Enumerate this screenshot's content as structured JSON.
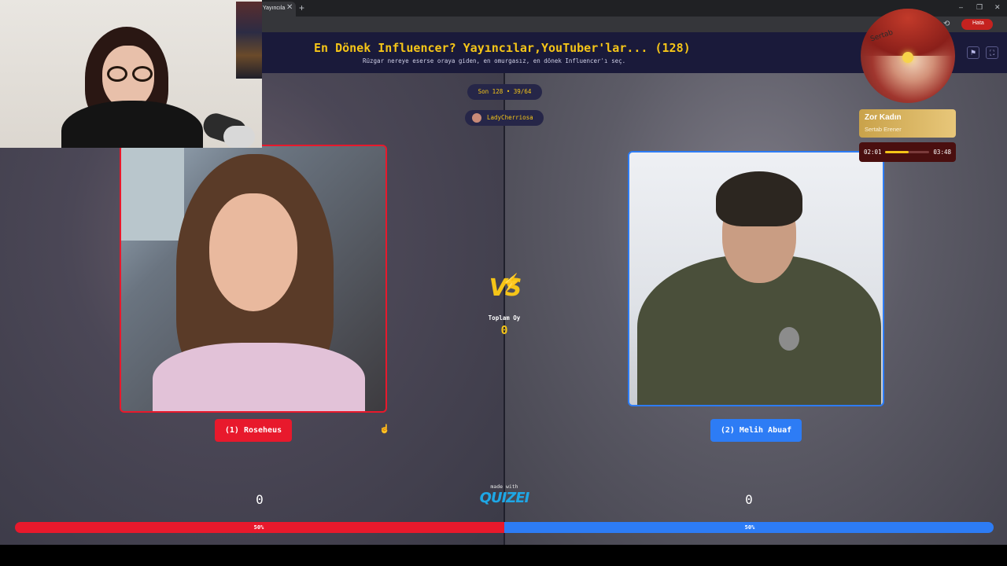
{
  "browser": {
    "tab_title": "Yayıncıla",
    "tab_close": "✕",
    "new_tab": "+",
    "minimize": "–",
    "restore": "❐",
    "close": "✕",
    "error_badge": "Hata"
  },
  "header": {
    "title": "En Dönek Influencer? Yayıncılar,YouTuber'lar... (128)",
    "subtitle": "Rüzgar nereye eserse oraya giden, en omurgasız, en dönek Influencer'ı seç.",
    "flag_icon": "⚑",
    "fullscreen_icon": "⛶"
  },
  "match": {
    "round": "Son 128 • 39/64",
    "user": "LadyCherriosa",
    "vs": "VS",
    "vs_bolt": "⚡",
    "total_label": "Toplam Oy",
    "total_votes": "0"
  },
  "left": {
    "name": "(1) Roseheus",
    "votes": "0",
    "percent_label": "50%",
    "share": 0.5,
    "color": "#e8192c"
  },
  "right": {
    "name": "(2) Melih Abuaf",
    "votes": "0",
    "percent_label": "50%",
    "share": 0.5,
    "color": "#2d7cf5"
  },
  "footer": {
    "made_with": "made with",
    "logo": "QUIZEI"
  },
  "now_playing": {
    "title": "Zor Kadın",
    "artist": "Sertab Erener",
    "current_time": "02:01",
    "total_time": "03:48",
    "progress": 0.53,
    "album_text": "Sertab"
  }
}
